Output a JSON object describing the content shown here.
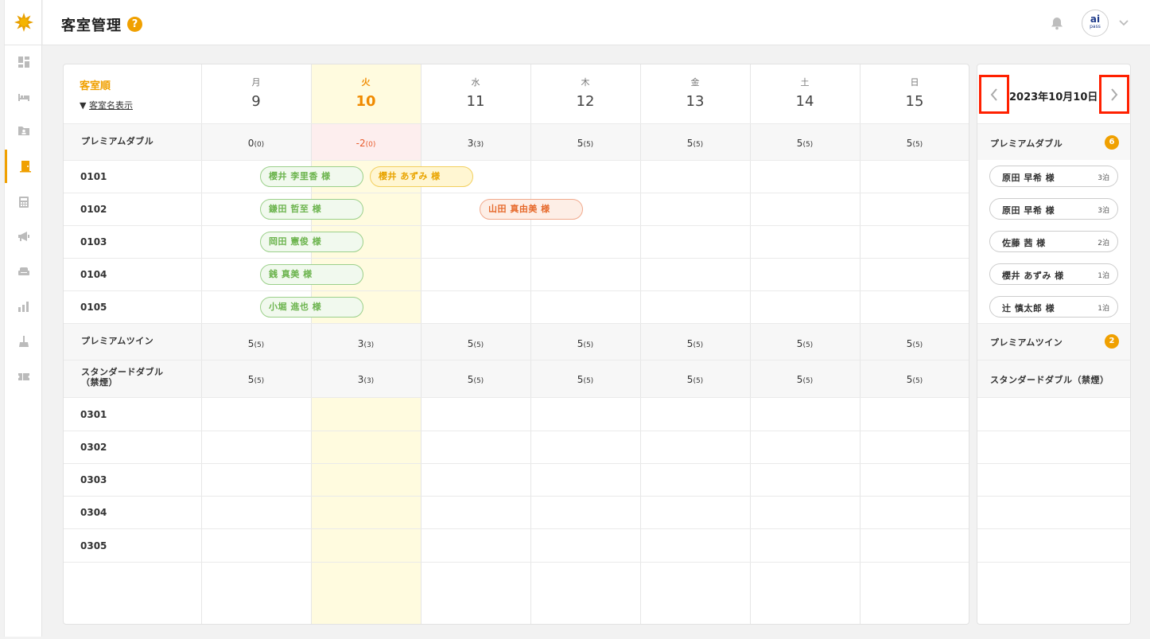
{
  "header": {
    "title": "客室管理",
    "help": "?"
  },
  "avatar": {
    "line1": "ai",
    "line2": "pass"
  },
  "sidebar": {
    "icons": [
      "logo-sun-icon",
      "dashboard-icon",
      "bed-icon",
      "folder-user-icon",
      "room-door-icon",
      "calculator-icon",
      "megaphone-icon",
      "sofa-icon",
      "bar-chart-icon",
      "cleaning-icon",
      "ticket-icon"
    ],
    "active_index": 4
  },
  "calendar": {
    "sort_label": "客室順",
    "view_toggle": "客室名表示",
    "toggle_arrow": "▼",
    "days": [
      {
        "dow": "月",
        "num": "9"
      },
      {
        "dow": "火",
        "num": "10",
        "today": true
      },
      {
        "dow": "水",
        "num": "11"
      },
      {
        "dow": "木",
        "num": "12"
      },
      {
        "dow": "金",
        "num": "13"
      },
      {
        "dow": "土",
        "num": "14"
      },
      {
        "dow": "日",
        "num": "15"
      }
    ],
    "categories": [
      {
        "name": "プレミアムダブル",
        "counts": [
          [
            "0",
            "(0)"
          ],
          [
            "-2",
            "(0)"
          ],
          [
            "3",
            "(3)"
          ],
          [
            "5",
            "(5)"
          ],
          [
            "5",
            "(5)"
          ],
          [
            "5",
            "(5)"
          ],
          [
            "5",
            "(5)"
          ]
        ],
        "rooms": [
          "0101",
          "0102",
          "0103",
          "0104",
          "0105"
        ]
      },
      {
        "name": "プレミアムツイン",
        "counts": [
          [
            "5",
            "(5)"
          ],
          [
            "3",
            "(3)"
          ],
          [
            "5",
            "(5)"
          ],
          [
            "5",
            "(5)"
          ],
          [
            "5",
            "(5)"
          ],
          [
            "5",
            "(5)"
          ],
          [
            "5",
            "(5)"
          ]
        ],
        "rooms": []
      },
      {
        "name_line1": "スタンダードダブル",
        "name_line2": "（禁煙）",
        "counts": [
          [
            "5",
            "(5)"
          ],
          [
            "3",
            "(3)"
          ],
          [
            "5",
            "(5)"
          ],
          [
            "5",
            "(5)"
          ],
          [
            "5",
            "(5)"
          ],
          [
            "5",
            "(5)"
          ],
          [
            "5",
            "(5)"
          ]
        ],
        "rooms": [
          "0301",
          "0302",
          "0303",
          "0304",
          "0305"
        ]
      }
    ],
    "bookings": [
      {
        "room": "0101",
        "guest": "櫻井 李里香  様",
        "color": "green"
      },
      {
        "room": "0101",
        "guest": "櫻井 あずみ  様",
        "color": "yellow"
      },
      {
        "room": "0102",
        "guest": "鎌田 哲至  様",
        "color": "green"
      },
      {
        "room": "0102",
        "guest": "山田 真由美  様",
        "color": "orange"
      },
      {
        "room": "0103",
        "guest": "岡田 憲俊  様",
        "color": "green"
      },
      {
        "room": "0104",
        "guest": "銭 真美  様",
        "color": "green"
      },
      {
        "room": "0105",
        "guest": "小堀 進也  様",
        "color": "green"
      }
    ]
  },
  "panel": {
    "date": "2023年10月10日",
    "sections": [
      {
        "name": "プレミアムダブル",
        "badge": "6",
        "guests": [
          {
            "name": "原田 早希  様",
            "stay": "3泊"
          },
          {
            "name": "原田 早希  様",
            "stay": "3泊"
          },
          {
            "name": "佐藤 茜  様",
            "stay": "2泊"
          },
          {
            "name": "櫻井 あずみ  様",
            "stay": "1泊"
          },
          {
            "name": "辻 慎太郎  様",
            "stay": "1泊"
          }
        ]
      },
      {
        "name": "プレミアムツイン",
        "badge": "2",
        "guests": []
      },
      {
        "name": "スタンダードダブル（禁煙）",
        "guests": []
      }
    ]
  },
  "colors": {
    "accent": "#f0a000",
    "today_bg": "#fffbdf",
    "highlight_border": "#ff2000"
  }
}
